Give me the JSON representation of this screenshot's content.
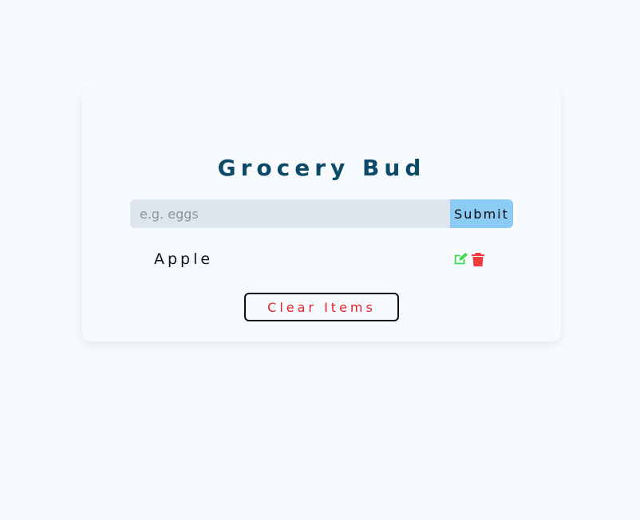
{
  "app": {
    "title": "Grocery Bud"
  },
  "form": {
    "placeholder": "e.g. eggs",
    "value": "",
    "submit_label": "Submit"
  },
  "items": [
    {
      "name": "Apple",
      "edit_icon": "edit-icon",
      "delete_icon": "trash-icon"
    }
  ],
  "clear_label": "Clear Items",
  "colors": {
    "title": "#0d4a6a",
    "submit_bg": "#8ccbf4",
    "input_bg": "#dde5ef",
    "edit": "#3ddc4f",
    "delete": "#ef3b3b",
    "clear_text": "#e0242a"
  }
}
